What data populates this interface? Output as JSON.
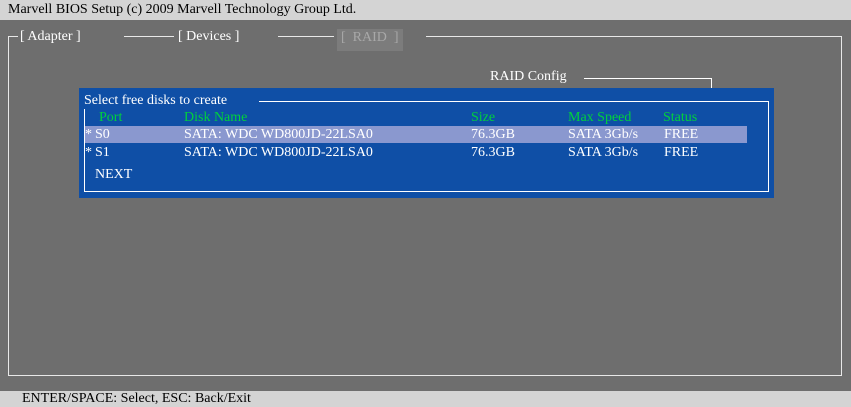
{
  "window": {
    "title": "Marvell BIOS Setup (c) 2009 Marvell Technology Group Ltd."
  },
  "tabs": [
    {
      "label": "[ Adapter ]",
      "active": false
    },
    {
      "label": "[ Devices ]",
      "active": false
    },
    {
      "label": "[  RAID  ]",
      "active": true
    }
  ],
  "section": {
    "label": "RAID Config"
  },
  "dialog": {
    "title": "Select free disks to create",
    "columns": [
      "Port",
      "Disk Name",
      "Size",
      "Max Speed",
      "Status"
    ],
    "rows": [
      {
        "marker": "*",
        "port": "S0",
        "disk_name": "SATA: WDC WD800JD-22LSA0",
        "size": "76.3GB",
        "max_speed": "SATA 3Gb/s",
        "status": "FREE",
        "selected": true
      },
      {
        "marker": "*",
        "port": "S1",
        "disk_name": "SATA: WDC WD800JD-22LSA0",
        "size": "76.3GB",
        "max_speed": "SATA 3Gb/s",
        "status": "FREE",
        "selected": false
      }
    ],
    "next_label": "NEXT"
  },
  "status_bar": {
    "help": "ENTER/SPACE: Select, ESC: Back/Exit"
  },
  "colors": {
    "background": "#6e6e6e",
    "dialog": "#0f4fa6",
    "header_text": "#00d23c",
    "selected_row": "#8a98cf",
    "bar": "#d4d4d4"
  }
}
